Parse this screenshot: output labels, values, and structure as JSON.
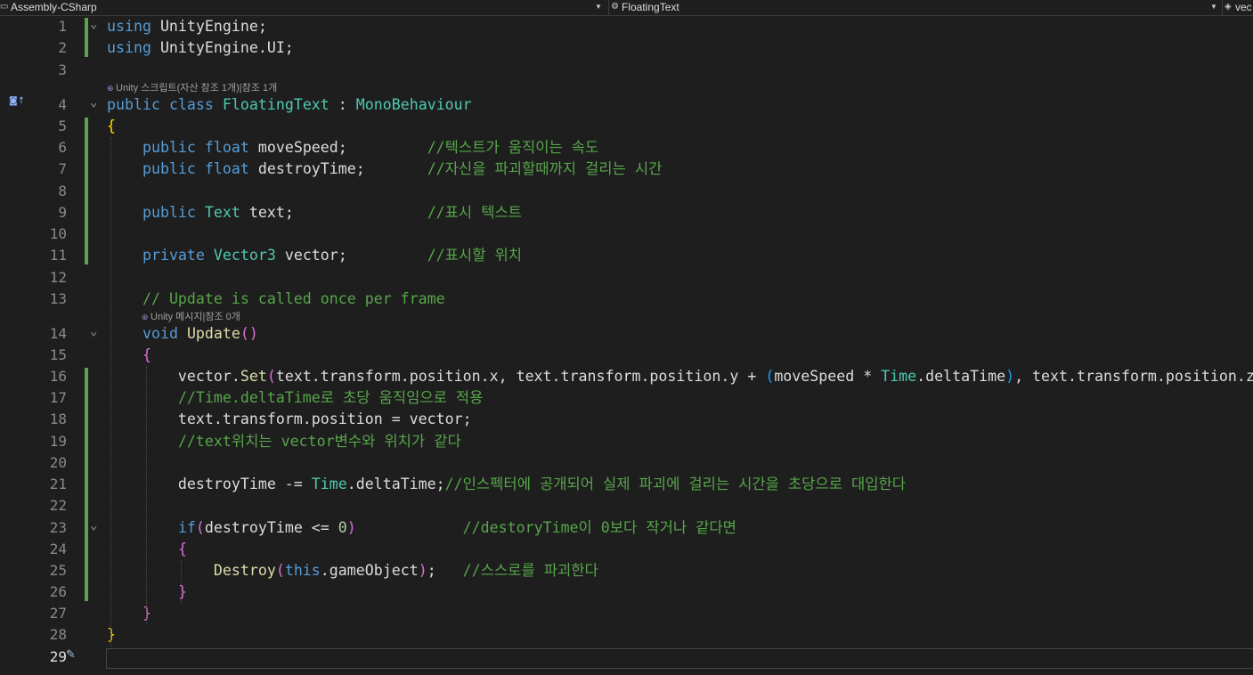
{
  "navbar": {
    "project": "Assembly-CSharp",
    "class": "FloatingText",
    "member": "vec"
  },
  "codelens": {
    "class_refs": "Unity 스크립트(자산 참조 1개)|참조 1개",
    "method_refs": "Unity 메시지|참조 0개"
  },
  "lines": [
    {
      "n": "1",
      "t": "using UnityEngine;"
    },
    {
      "n": "2",
      "t": "using UnityEngine.UI;"
    },
    {
      "n": "3",
      "t": ""
    },
    {
      "n": "4",
      "t": "public class FloatingText : MonoBehaviour"
    },
    {
      "n": "5",
      "t": "{"
    },
    {
      "n": "6",
      "t": "    public float moveSpeed;         //텍스트가 움직이는 속도"
    },
    {
      "n": "7",
      "t": "    public float destroyTime;       //자신을 파괴할때까지 걸리는 시간"
    },
    {
      "n": "8",
      "t": ""
    },
    {
      "n": "9",
      "t": "    public Text text;               //표시 텍스트"
    },
    {
      "n": "10",
      "t": ""
    },
    {
      "n": "11",
      "t": "    private Vector3 vector;         //표시할 위치"
    },
    {
      "n": "12",
      "t": ""
    },
    {
      "n": "13",
      "t": "    // Update is called once per frame"
    },
    {
      "n": "14",
      "t": "    void Update()"
    },
    {
      "n": "15",
      "t": "    {"
    },
    {
      "n": "16",
      "t": "        vector.Set(text.transform.position.x, text.transform.position.y + (moveSpeed * Time.deltaTime), text.transform.position.z);"
    },
    {
      "n": "17",
      "t": "        //Time.deltaTime로 초당 움직임으로 적용"
    },
    {
      "n": "18",
      "t": "        text.transform.position = vector;"
    },
    {
      "n": "19",
      "t": "        //text위치는 vector변수와 위치가 같다"
    },
    {
      "n": "20",
      "t": ""
    },
    {
      "n": "21",
      "t": "        destroyTime -= Time.deltaTime;//인스펙터에 공개되어 실제 파괴에 걸리는 시간을 초당으로 대입한다"
    },
    {
      "n": "22",
      "t": ""
    },
    {
      "n": "23",
      "t": "        if(destroyTime <= 0)            //destoryTime이 0보다 작거나 같다면"
    },
    {
      "n": "24",
      "t": "        {"
    },
    {
      "n": "25",
      "t": "            Destroy(this.gameObject);   //스스로를 파괴한다"
    },
    {
      "n": "26",
      "t": "        }"
    },
    {
      "n": "27",
      "t": "    }"
    },
    {
      "n": "28",
      "t": "}"
    },
    {
      "n": "29",
      "t": ""
    }
  ],
  "colors": {
    "background": "#1e1e1e",
    "keyword": "#569cd6",
    "type": "#4ec9b0",
    "method": "#dcdcaa",
    "comment": "#57a64a",
    "number": "#b5cea8",
    "bracket_level1": "#ffd700",
    "bracket_level2": "#da70d6",
    "bracket_level3": "#179fff",
    "change_marker": "#57a64a"
  }
}
